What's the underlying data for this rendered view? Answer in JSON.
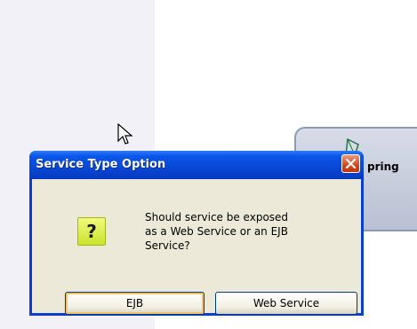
{
  "background_node": {
    "label": "pring"
  },
  "dialog": {
    "title": "Service Type Option",
    "message": "Should service be exposed as a Web Service or an EJB Service?",
    "icon": "question-icon",
    "buttons": {
      "ejb_label": "EJB",
      "web_service_label": "Web Service"
    }
  },
  "colors": {
    "titlebar": "#0a55e8",
    "client": "#ece9d8",
    "close_button": "#d2471d",
    "question_icon": "#c9e32c"
  }
}
